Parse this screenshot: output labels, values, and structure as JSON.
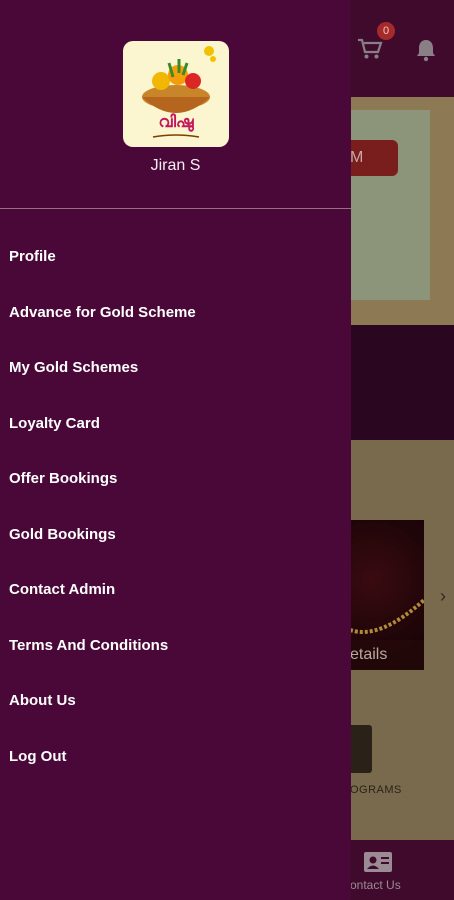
{
  "background": {
    "cart_badge": "0",
    "partial_button_text": "M",
    "product_caption": "etails",
    "programs_label": "OGRAMS",
    "contact_label": "ontact Us"
  },
  "drawer": {
    "user_name": "Jiran S",
    "logo_text": "വിഷു",
    "menu": [
      {
        "label": "Profile"
      },
      {
        "label": "Advance for Gold Scheme"
      },
      {
        "label": "My Gold Schemes"
      },
      {
        "label": "Loyalty Card"
      },
      {
        "label": "Offer Bookings"
      },
      {
        "label": "Gold Bookings"
      },
      {
        "label": "Contact Admin"
      },
      {
        "label": "Terms And Conditions"
      },
      {
        "label": "About Us"
      },
      {
        "label": "Log Out"
      }
    ]
  },
  "colors": {
    "drawer_bg": "#4a0838",
    "accent_red": "#a52a2a",
    "gold": "#7a6a4d"
  }
}
